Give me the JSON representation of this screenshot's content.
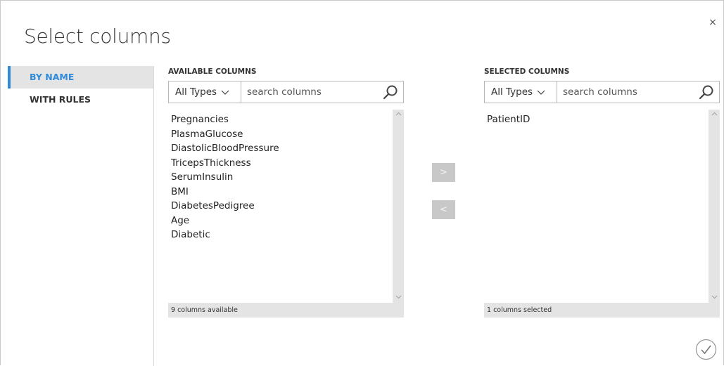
{
  "dialog": {
    "title": "Select columns",
    "close_label": "×"
  },
  "nav": {
    "items": [
      {
        "label": "BY NAME",
        "active": true
      },
      {
        "label": "WITH RULES",
        "active": false
      }
    ]
  },
  "available": {
    "header": "AVAILABLE COLUMNS",
    "type_filter": "All Types",
    "search_placeholder": "search columns",
    "columns": [
      "Pregnancies",
      "PlasmaGlucose",
      "DiastolicBloodPressure",
      "TricepsThickness",
      "SerumInsulin",
      "BMI",
      "DiabetesPedigree",
      "Age",
      "Diabetic"
    ],
    "status": "9 columns available"
  },
  "selected": {
    "header": "SELECTED COLUMNS",
    "type_filter": "All Types",
    "search_placeholder": "search columns",
    "columns": [
      "PatientID"
    ],
    "status": "1 columns selected"
  },
  "buttons": {
    "add_label": ">",
    "remove_label": "<"
  },
  "colors": {
    "accent": "#2f8bd9",
    "panel_gray": "#e4e4e4",
    "button_gray": "#c8c8c8"
  },
  "icons": {
    "close": "close-icon",
    "search": "search-icon",
    "chevron": "chevron-down-icon",
    "confirm": "checkmark-circle-icon"
  }
}
